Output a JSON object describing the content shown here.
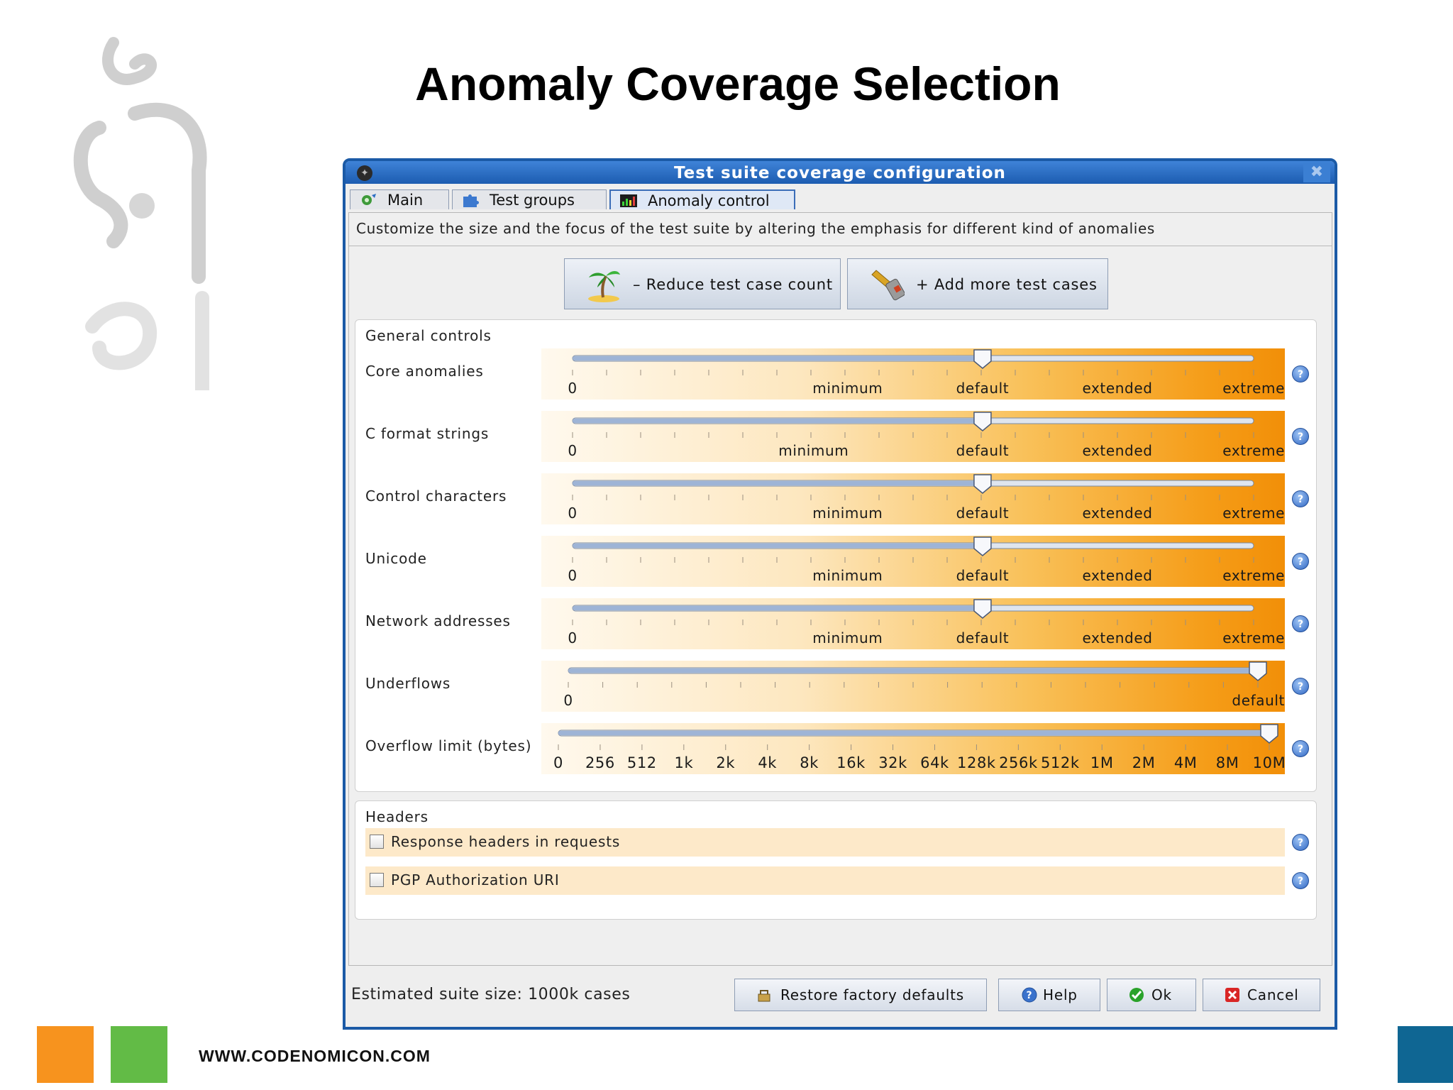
{
  "slide": {
    "title": "Anomaly Coverage Selection",
    "footer_url": "WWW.CODENOMICON.COM",
    "square_colors": [
      "#f7931e",
      "#62bb46",
      "#0f6693"
    ]
  },
  "window": {
    "title": "Test suite coverage configuration",
    "close_glyph": "✖",
    "accent": "#1b5aa6"
  },
  "tabs": [
    {
      "label": "Main",
      "icon": "gear-icon"
    },
    {
      "label": "Test groups",
      "icon": "puzzle-icon"
    },
    {
      "label": "Anomaly control",
      "icon": "chart-icon",
      "active": true
    }
  ],
  "description": "Customize the size and the focus of the test suite by altering the emphasis for different kind of anomalies",
  "buttons": {
    "reduce": "– Reduce test case count",
    "add": "+ Add more test cases"
  },
  "general": {
    "title": "General controls",
    "sliders": [
      {
        "label": "Core anomalies",
        "value": "default",
        "scale": [
          {
            "t": "0",
            "p": 0
          },
          {
            "t": "minimum",
            "p": 0.404
          },
          {
            "t": "default",
            "p": 0.602
          },
          {
            "t": "extended",
            "p": 0.8
          },
          {
            "t": "extreme",
            "p": 1
          }
        ]
      },
      {
        "label": "C format strings",
        "value": "default",
        "scale": [
          {
            "t": "0",
            "p": 0
          },
          {
            "t": "minimum",
            "p": 0.354
          },
          {
            "t": "default",
            "p": 0.602
          },
          {
            "t": "extended",
            "p": 0.8
          },
          {
            "t": "extreme",
            "p": 1
          }
        ]
      },
      {
        "label": "Control characters",
        "value": "default",
        "scale": [
          {
            "t": "0",
            "p": 0
          },
          {
            "t": "minimum",
            "p": 0.404
          },
          {
            "t": "default",
            "p": 0.602
          },
          {
            "t": "extended",
            "p": 0.8
          },
          {
            "t": "extreme",
            "p": 1
          }
        ]
      },
      {
        "label": "Unicode",
        "value": "default",
        "scale": [
          {
            "t": "0",
            "p": 0
          },
          {
            "t": "minimum",
            "p": 0.404
          },
          {
            "t": "default",
            "p": 0.602
          },
          {
            "t": "extended",
            "p": 0.8
          },
          {
            "t": "extreme",
            "p": 1
          }
        ]
      },
      {
        "label": "Network addresses",
        "value": "default",
        "scale": [
          {
            "t": "0",
            "p": 0
          },
          {
            "t": "minimum",
            "p": 0.404
          },
          {
            "t": "default",
            "p": 0.602
          },
          {
            "t": "extended",
            "p": 0.8
          },
          {
            "t": "extreme",
            "p": 1
          }
        ]
      },
      {
        "label": "Underflows",
        "value": "default",
        "scale": [
          {
            "t": "0",
            "p": 0
          },
          {
            "t": "default",
            "p": 1
          }
        ]
      },
      {
        "label": "Overflow limit (bytes)",
        "value": "10M",
        "scale": [
          {
            "t": "0",
            "p": 0
          },
          {
            "t": "256",
            "p": 0.0588
          },
          {
            "t": "512",
            "p": 0.1176
          },
          {
            "t": "1k",
            "p": 0.1765
          },
          {
            "t": "2k",
            "p": 0.2353
          },
          {
            "t": "4k",
            "p": 0.2941
          },
          {
            "t": "8k",
            "p": 0.3529
          },
          {
            "t": "16k",
            "p": 0.4118
          },
          {
            "t": "32k",
            "p": 0.4706
          },
          {
            "t": "64k",
            "p": 0.5294
          },
          {
            "t": "128k",
            "p": 0.5882
          },
          {
            "t": "256k",
            "p": 0.6471
          },
          {
            "t": "512k",
            "p": 0.7059
          },
          {
            "t": "1M",
            "p": 0.7647
          },
          {
            "t": "2M",
            "p": 0.8235
          },
          {
            "t": "4M",
            "p": 0.8824
          },
          {
            "t": "8M",
            "p": 0.9412
          },
          {
            "t": "10M",
            "p": 1
          }
        ]
      }
    ]
  },
  "headers": {
    "title": "Headers",
    "options": [
      {
        "label": "Response headers in requests",
        "checked": false
      },
      {
        "label": "PGP Authorization URI",
        "checked": false
      }
    ]
  },
  "status": {
    "estimate": "Estimated suite size: 1000k cases",
    "restore": "Restore factory defaults",
    "help": "Help",
    "ok": "Ok",
    "cancel": "Cancel"
  }
}
